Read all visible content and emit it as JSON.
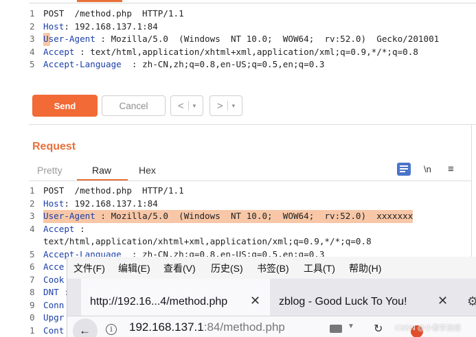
{
  "top_request": {
    "lines": [
      {
        "n": "1",
        "key": "",
        "rest": "POST  /method.php  HTTP/1.1",
        "highlight": false
      },
      {
        "n": "2",
        "key": "Host",
        "rest": ": 192.168.137.1:84",
        "highlight": false
      },
      {
        "n": "3",
        "key": "User-Agent",
        "rest": " : Mozilla/5.0  (Windows  NT 10.0;  WOW64;  rv:52.0)  Gecko/201001",
        "highlight": true
      },
      {
        "n": "4",
        "key": "Accept",
        "rest": " : text/html,application/xhtml+xml,application/xml;q=0.9,*/*;q=0.8",
        "highlight": false
      },
      {
        "n": "5",
        "key": "Accept-Language",
        "rest": "  : zh-CN,zh;q=0.8,en-US;q=0.5,en;q=0.3",
        "highlight": false
      }
    ]
  },
  "buttons": {
    "send": "Send",
    "cancel": "Cancel",
    "back": "<",
    "forward": ">",
    "dropdown": "▾"
  },
  "request_panel": {
    "title": "Request",
    "tabs": {
      "pretty": "Pretty",
      "raw": "Raw",
      "hex": "Hex"
    },
    "active_tab": "Raw",
    "newline_toggle": "\\n",
    "menu": "≡",
    "lines": [
      {
        "n": "1",
        "key": "",
        "rest": "POST  /method.php  HTTP/1.1",
        "highlight": false
      },
      {
        "n": "2",
        "key": "Host",
        "rest": ": 192.168.137.1:84",
        "highlight": false
      },
      {
        "n": "3",
        "key": "User-Agent",
        "rest": " : Mozilla/5.0  (Windows  NT 10.0;  WOW64;  rv:52.0)  xxxxxxx",
        "highlight": true
      },
      {
        "n": "4",
        "key": "Accept",
        "rest": " :",
        "highlight": false
      },
      {
        "n": "",
        "key": "",
        "rest": "text/html,application/xhtml+xml,application/xml;q=0.9,*/*;q=0.8",
        "highlight": false
      },
      {
        "n": "5",
        "key": "Accept-Language",
        "rest": "  : zh-CN,zh;q=0.8,en-US;q=0.5,en;q=0.3",
        "highlight": false
      },
      {
        "n": "6",
        "key": "Acce",
        "rest": "",
        "highlight": false
      },
      {
        "n": "7",
        "key": "Cook",
        "rest": "",
        "highlight": false
      },
      {
        "n": "8",
        "key": "DNT",
        "rest": " :",
        "highlight": false
      },
      {
        "n": "9",
        "key": "Conn",
        "rest": "",
        "highlight": false
      },
      {
        "n": "0",
        "key": "Upgr",
        "rest": "",
        "highlight": false
      },
      {
        "n": "1",
        "key": "Cont",
        "rest": "",
        "highlight": false
      }
    ]
  },
  "firefox": {
    "menu": [
      "文件(F)",
      "编辑(E)",
      "查看(V)",
      "历史(S)",
      "书签(B)",
      "工具(T)",
      "帮助(H)"
    ],
    "tabs": [
      {
        "title": "http://192.16...4/method.php",
        "close": "✕"
      },
      {
        "title": "zblog - Good Luck To You!",
        "close": "✕"
      }
    ],
    "url_host": "192.168.137.1",
    "url_rest": ":84/method.php",
    "info": "i"
  },
  "watermark": "CSDN @小看学流感",
  "colors": {
    "accent": "#e8703a",
    "send": "#f26a35",
    "highlight": "#f7c7a7",
    "key": "#1a3ea8",
    "wrap": "#4a74c9"
  }
}
